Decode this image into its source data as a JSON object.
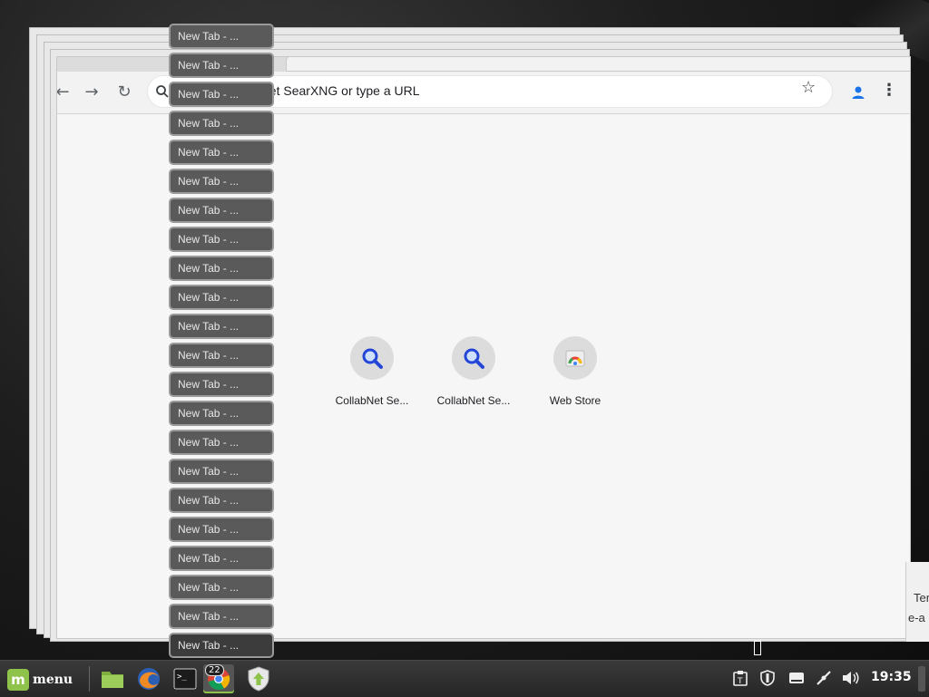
{
  "switcher": {
    "items": [
      "New Tab - ...",
      "New Tab - ...",
      "New Tab - ...",
      "New Tab - ...",
      "New Tab - ...",
      "New Tab - ...",
      "New Tab - ...",
      "New Tab - ...",
      "New Tab - ...",
      "New Tab - ...",
      "New Tab - ...",
      "New Tab - ...",
      "New Tab - ...",
      "New Tab - ...",
      "New Tab - ...",
      "New Tab - ...",
      "New Tab - ...",
      "New Tab - ...",
      "New Tab - ...",
      "New Tab - ...",
      "New Tab - ...",
      "New Tab - ..."
    ]
  },
  "browser": {
    "omnibox_text": "CollabNet SearXNG or type a URL",
    "shortcuts": [
      {
        "label": "CollabNet Se...",
        "icon": "search-icon"
      },
      {
        "label": "CollabNet Se...",
        "icon": "search-icon"
      },
      {
        "label": "Web Store",
        "icon": "web-store-icon"
      }
    ]
  },
  "side_window": {
    "line1": "Ter",
    "line2": "e-a"
  },
  "taskbar": {
    "menu_label": "menu",
    "chrome_badge": "22",
    "clock": "19:35",
    "accent": "#8fc24a"
  }
}
